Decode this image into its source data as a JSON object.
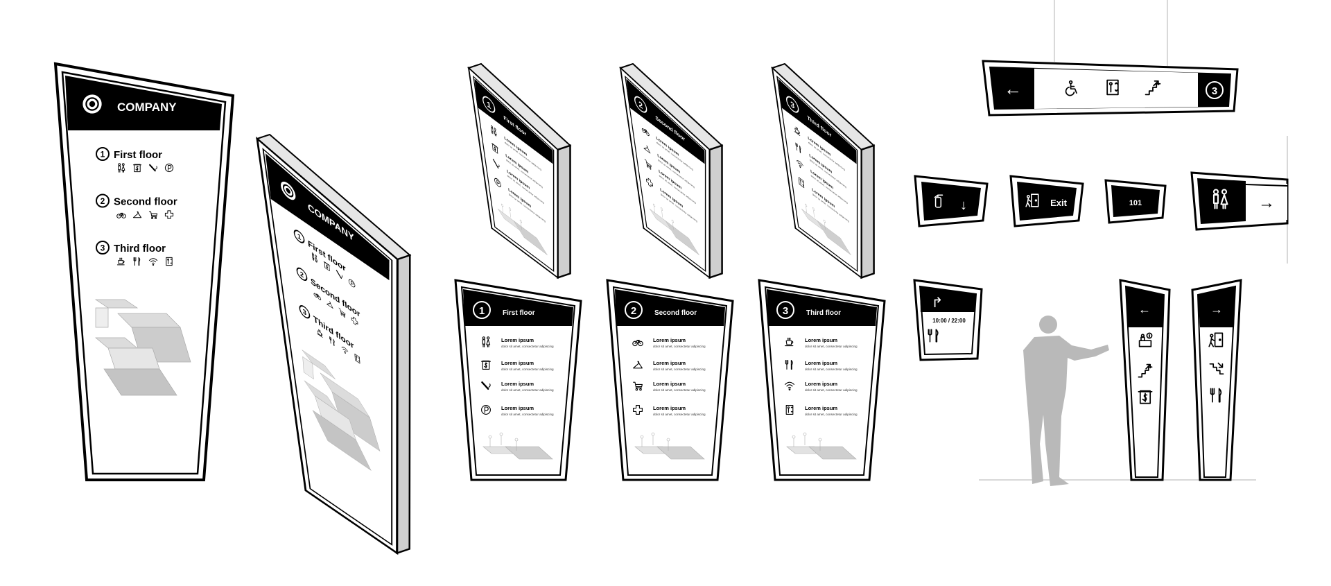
{
  "company": {
    "name": "COMPANY",
    "logo_icon": "swirl-logo"
  },
  "floors": [
    {
      "number": "1",
      "name": "First floor",
      "icons": [
        "restroom",
        "atm",
        "smoking",
        "parking"
      ]
    },
    {
      "number": "2",
      "name": "Second floor",
      "icons": [
        "bicycle",
        "hanger",
        "cart",
        "first-aid"
      ]
    },
    {
      "number": "3",
      "name": "Third floor",
      "icons": [
        "coffee",
        "restaurant",
        "wifi",
        "elevator"
      ]
    }
  ],
  "item": {
    "title": "Lorem ipsum",
    "description": "dolor sit amet, consectetur adipiscing"
  },
  "hanging_sign": {
    "arrow": "←",
    "icons": [
      "wheelchair",
      "elevator",
      "escalator-up"
    ],
    "floor": "3"
  },
  "fire_sign": {
    "icon": "fire-extinguisher",
    "arrow": "↓"
  },
  "exit_sign": {
    "icon": "exit-door",
    "label": "Exit"
  },
  "room_sign": {
    "label": "101"
  },
  "restroom_sign": {
    "icon": "restroom",
    "arrow": "→"
  },
  "hours_sign": {
    "arrow": "↱",
    "hours": "10:00 / 22:00",
    "icon": "restaurant"
  },
  "totem_left": {
    "arrow": "←",
    "icons": [
      "info-desk",
      "escalator-up",
      "atm"
    ]
  },
  "totem_right": {
    "arrow": "→",
    "icons": [
      "exit-door",
      "escalator-down",
      "restaurant"
    ]
  },
  "colors": {
    "ink": "#000000",
    "paper": "#ffffff",
    "side": "#cfcfcf",
    "map": "#c8c8c8",
    "person": "#b9b9b9"
  }
}
